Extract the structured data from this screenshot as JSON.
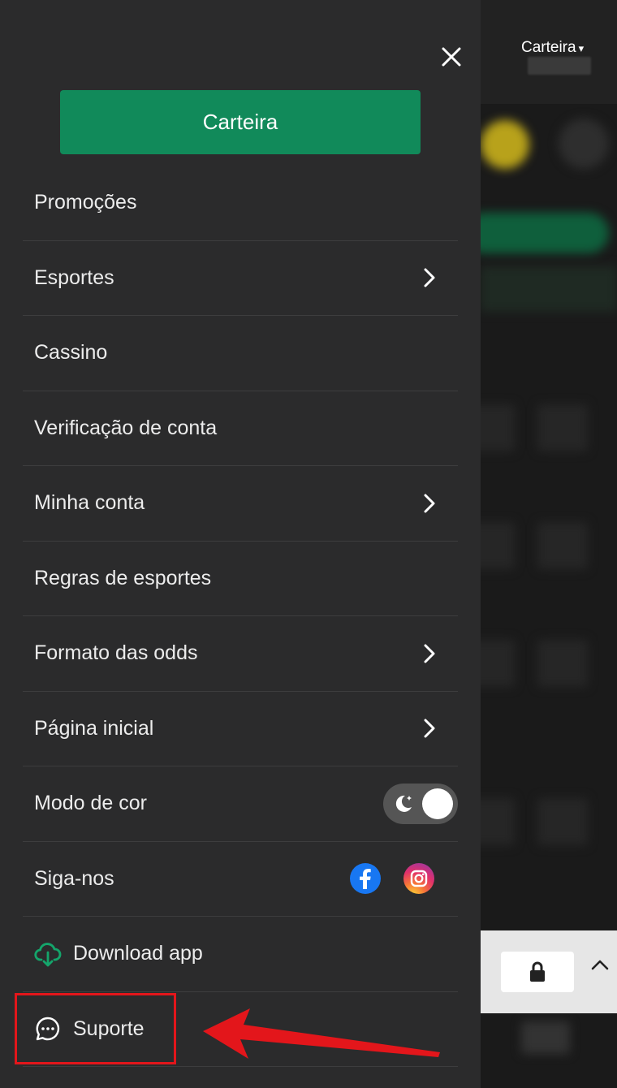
{
  "header": {
    "wallet_label": "Carteira",
    "wallet_caret": "▾"
  },
  "drawer": {
    "close_icon": "close-icon",
    "wallet_button": "Carteira",
    "menu": [
      {
        "label": "Promoções",
        "chevron": false
      },
      {
        "label": "Esportes",
        "chevron": true
      },
      {
        "label": "Cassino",
        "chevron": false
      },
      {
        "label": "Verificação de conta",
        "chevron": false
      },
      {
        "label": "Minha conta",
        "chevron": true
      },
      {
        "label": "Regras de esportes",
        "chevron": false
      },
      {
        "label": "Formato das odds",
        "chevron": true
      },
      {
        "label": "Página inicial",
        "chevron": true
      },
      {
        "label": "Modo de cor",
        "control": "dark-mode-toggle",
        "toggle_on": true
      },
      {
        "label": "Siga-nos",
        "icons": [
          "facebook-icon",
          "instagram-icon"
        ]
      },
      {
        "label": "Download app",
        "icon": "cloud-download-icon"
      },
      {
        "label": "Suporte",
        "icon": "chat-bubble-icon"
      }
    ]
  },
  "colors": {
    "accent_green": "#118a5a",
    "drawer_bg": "#2b2b2c",
    "annotation_red": "#e3161b",
    "facebook_blue": "#1877f2"
  },
  "background": {
    "lock_icon": "lock-icon",
    "chevron_up_icon": "chevron-up-icon"
  }
}
